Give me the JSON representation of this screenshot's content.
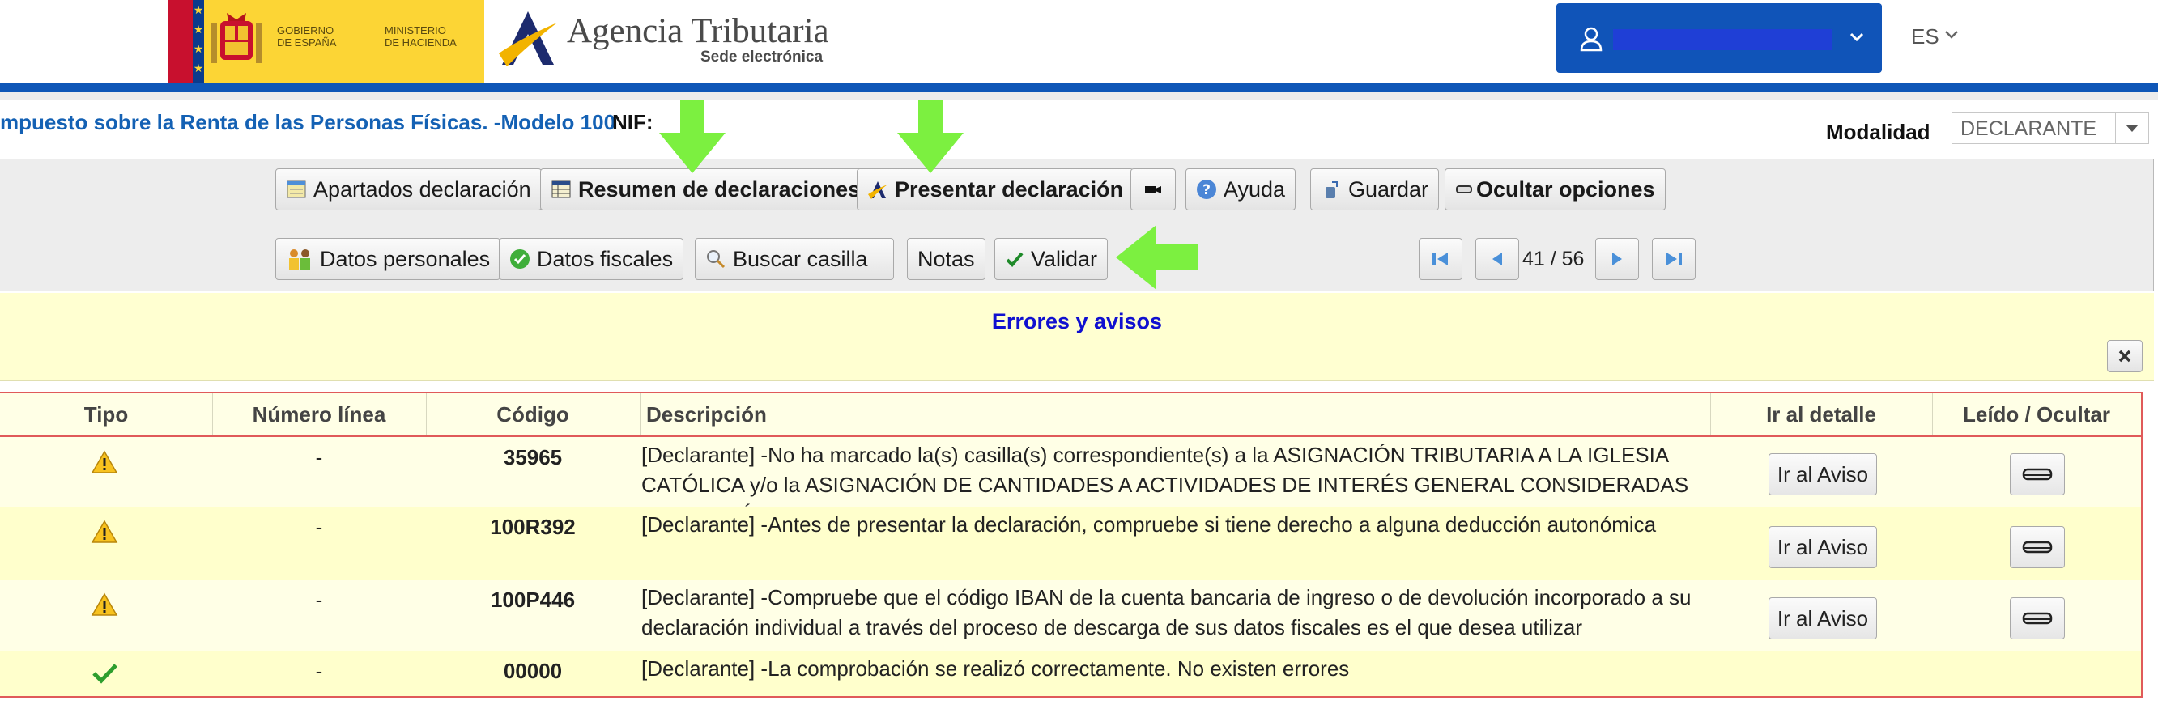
{
  "header": {
    "gov_line1": "GOBIERNO",
    "gov_line2": "DE ESPAÑA",
    "ministry_line1": "MINISTERIO",
    "ministry_line2": "DE HACIENDA",
    "agency_title": "Agencia Tributaria",
    "agency_subtitle": "Sede electrónica",
    "language": "ES",
    "user_name": ""
  },
  "form": {
    "title": "mpuesto sobre la Renta de las Personas Físicas. -Modelo 100",
    "nif_label": "NIF:",
    "modalidad_label": "Modalidad",
    "modalidad_value": "DECLARANTE"
  },
  "toolbar": {
    "apartados": "Apartados declaración",
    "resumen": "Resumen de declaraciones",
    "presentar": "Presentar declaración",
    "ayuda": "Ayuda",
    "guardar": "Guardar",
    "ocultar": "Ocultar opciones",
    "datos_personales": "Datos personales",
    "datos_fiscales": "Datos fiscales",
    "buscar": "Buscar casilla",
    "notas": "Notas",
    "validar": "Validar",
    "page_indicator": "41 / 56"
  },
  "errors": {
    "title": "Errores y avisos",
    "columns": [
      "Tipo",
      "Número línea",
      "Código",
      "Descripción",
      "Ir al detalle",
      "Leído / Ocultar"
    ],
    "rows": [
      {
        "tipo": "warning-icon",
        "linea": "-",
        "codigo": "35965",
        "descripcion": "[Declarante] -No ha marcado la(s) casilla(s) correspondiente(s) a la ASIGNACIÓN TRIBUTARIA A LA IGLESIA CATÓLICA y/o la ASIGNACIÓN DE CANTIDADES A ACTIVIDADES DE INTERÉS GENERAL CONSIDERADAS DE INTERÉS SOCIAL",
        "detalle": "Ir al Aviso"
      },
      {
        "tipo": "warning-icon",
        "linea": "-",
        "codigo": "100R392",
        "descripcion": "[Declarante] -Antes de presentar la declaración, compruebe si tiene derecho a alguna deducción autonómica",
        "detalle": "Ir al Aviso"
      },
      {
        "tipo": "warning-icon",
        "linea": "-",
        "codigo": "100P446",
        "descripcion": "[Declarante] -Compruebe que el código IBAN de la cuenta bancaria de ingreso o de devolución incorporado a su declaración individual a través del proceso de descarga de sus datos fiscales es el que desea utilizar",
        "detalle": "Ir al Aviso"
      },
      {
        "tipo": "check-icon",
        "linea": "-",
        "codigo": "00000",
        "descripcion": "[Declarante] -La comprobación se realizó correctamente. No existen errores",
        "detalle": ""
      }
    ]
  },
  "colors": {
    "brand_blue": "#0f57b7",
    "title_blue": "#1461b4",
    "errors_title": "#1010d0",
    "errors_bg": "#ffffd1",
    "grid_border": "#e05a5a",
    "arrow_green": "#7cf040"
  }
}
